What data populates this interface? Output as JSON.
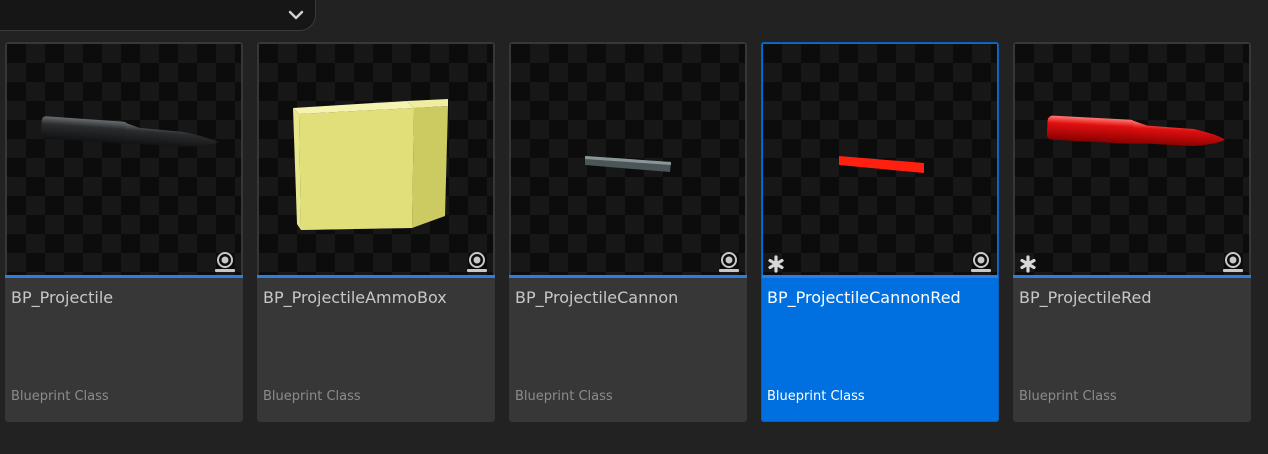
{
  "filter_bar": {
    "icon": "chevron-down-icon"
  },
  "assets": [
    {
      "name": "BP_Projectile",
      "type": "Blueprint Class",
      "thumbnail": "black-bullet",
      "selected": false,
      "modified": false
    },
    {
      "name": "BP_ProjectileAmmoBox",
      "type": "Blueprint Class",
      "thumbnail": "yellow-cube",
      "selected": false,
      "modified": false
    },
    {
      "name": "BP_ProjectileCannon",
      "type": "Blueprint Class",
      "thumbnail": "grey-rod",
      "selected": false,
      "modified": false
    },
    {
      "name": "BP_ProjectileCannonRed",
      "type": "Blueprint Class",
      "thumbnail": "red-rod",
      "selected": true,
      "modified": true
    },
    {
      "name": "BP_ProjectileRed",
      "type": "Blueprint Class",
      "thumbnail": "red-bullet",
      "selected": false,
      "modified": true
    }
  ],
  "colors": {
    "background": "#222222",
    "tile": "#373737",
    "selected_tile": "#0070e0",
    "accent_underline": "#2f7de0"
  }
}
